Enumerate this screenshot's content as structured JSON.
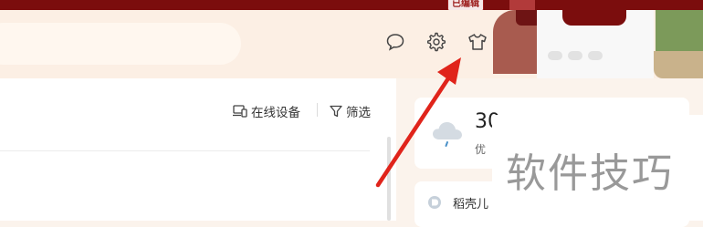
{
  "topbar": {
    "badge_text": "已编辑"
  },
  "header": {
    "icons": [
      "chat-bubble-icon",
      "gear-icon",
      "tshirt-icon"
    ]
  },
  "toolbar": {
    "online_devices_label": "在线设备",
    "filter_label": "筛选"
  },
  "weather": {
    "temperature": "30",
    "air_quality": "优"
  },
  "card2": {
    "label": "稻壳儿"
  },
  "watermark": {
    "text": "软件技巧"
  },
  "colors": {
    "topbar": "#7b0d0d",
    "header_bg": "#fcefe4",
    "annotation_arrow": "#e0241b"
  }
}
